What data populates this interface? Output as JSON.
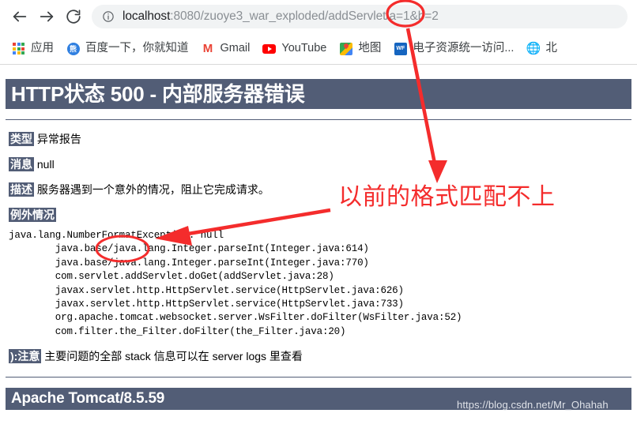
{
  "browser": {
    "back_icon": "back-arrow-icon",
    "forward_icon": "forward-arrow-icon",
    "reload_icon": "reload-icon",
    "site_info_icon": "site-info-icon",
    "url_host": "localhost",
    "url_rest": ":8080/zuoye3_war_exploded/addServlet/a=1&b=2",
    "url_full": "localhost:8080/zuoye3_war_exploded/addServlet/a=1&b=2",
    "bookmarks": [
      {
        "label": "应用",
        "icon": "apps-grid-icon"
      },
      {
        "label": "百度一下，你就知道",
        "icon": "baidu-icon"
      },
      {
        "label": "Gmail",
        "icon": "gmail-icon"
      },
      {
        "label": "YouTube",
        "icon": "youtube-icon"
      },
      {
        "label": "地图",
        "icon": "google-maps-icon"
      },
      {
        "label": "电子资源统一访问...",
        "icon": "library-icon"
      },
      {
        "label": "北",
        "icon": "globe-icon"
      }
    ]
  },
  "error_page": {
    "title": "HTTP状态 500 - 内部服务器错误",
    "type_label": "类型",
    "type_value": "异常报告",
    "message_label": "消息",
    "message_value": "null",
    "description_label": "描述",
    "description_value": "服务器遇到一个意外的情况，阻止它完成请求。",
    "exception_label": "例外情况",
    "stack_trace": "java.lang.NumberFormatException: null\n        java.base/java.lang.Integer.parseInt(Integer.java:614)\n        java.base/java.lang.Integer.parseInt(Integer.java:770)\n        com.servlet.addServlet.doGet(addServlet.java:28)\n        javax.servlet.http.HttpServlet.service(HttpServlet.java:626)\n        javax.servlet.http.HttpServlet.service(HttpServlet.java:733)\n        org.apache.tomcat.websocket.server.WsFilter.doFilter(WsFilter.java:52)\n        com.filter.the_Filter.doFilter(the_Filter.java:20)",
    "note_prefix": "):",
    "note_label": "注意",
    "note_value": "主要问题的全部 stack 信息可以在 server logs 里查看",
    "footer": "Apache Tomcat/8.5.59"
  },
  "annotations": {
    "comment_text": "以前的格式匹配不上",
    "comment_color": "#f42c2c",
    "circle_url_target": "/a",
    "circle_exception_target": "NumberFormat",
    "arrow_down_name": "arrow-url-to-comment",
    "arrow_left_name": "arrow-comment-to-exception"
  },
  "watermark": {
    "text": "https://blog.csdn.net/Mr_Ohahah"
  },
  "colors": {
    "tomcat_banner": "#525D76",
    "annotation_red": "#f42c2c",
    "omnibox_bg": "#f1f3f4"
  }
}
